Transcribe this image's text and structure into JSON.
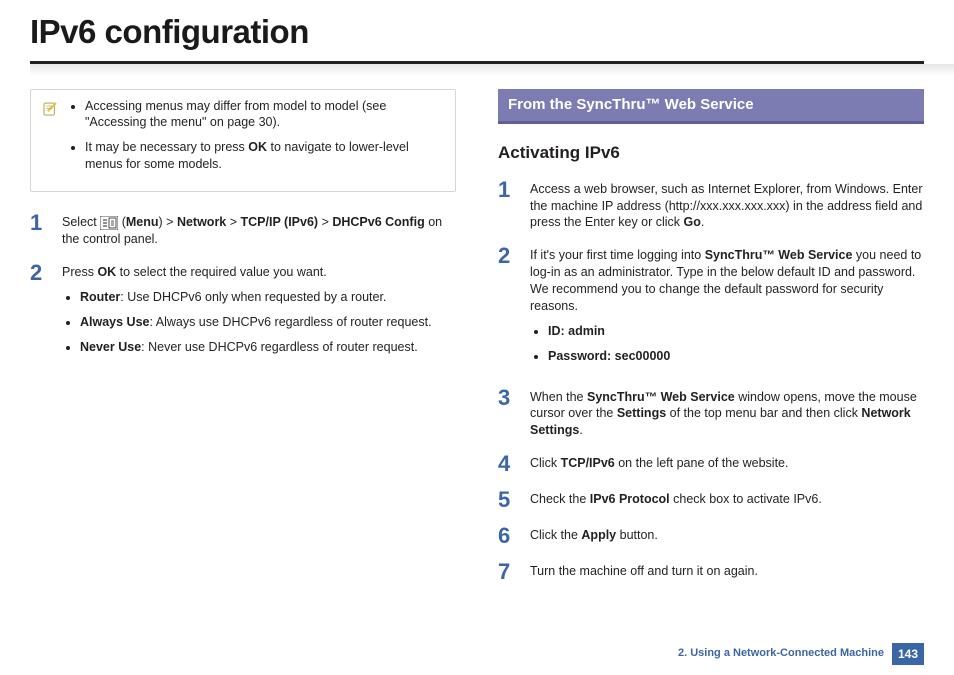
{
  "title": "IPv6 configuration",
  "left": {
    "note": {
      "items": [
        {
          "pre": "Accessing menus may differ from model to model (see \"Accessing the menu\" on page 30)."
        },
        {
          "pre": "It may be necessary to press ",
          "b1": "OK",
          "post": " to navigate to lower-level menus for some models."
        }
      ]
    },
    "step1": {
      "num": "1",
      "pre": "Select ",
      "post1": " (",
      "b1": "Menu",
      "post2": ") > ",
      "b2": "Network",
      "post3": " > ",
      "b3": "TCP/IP (IPv6)",
      "post4": " > ",
      "b4": "DHCPv6 Config",
      "post5": " on the control panel."
    },
    "step2": {
      "num": "2",
      "text_pre": "Press ",
      "text_b": "OK",
      "text_post": " to select the required value you want.",
      "items": [
        {
          "b": "Router",
          "text": ": Use DHCPv6 only when requested by a router."
        },
        {
          "b": "Always Use",
          "text": ": Always use DHCPv6 regardless of router request."
        },
        {
          "b": "Never Use",
          "text": ": Never use DHCPv6 regardless of router request."
        }
      ]
    }
  },
  "right": {
    "section_bar": "From the SyncThru™ Web Service",
    "h3": "Activating IPv6",
    "steps": {
      "s1": {
        "num": "1",
        "pre": "Access a web browser, such as Internet Explorer, from Windows.  Enter the machine IP address (http://xxx.xxx.xxx.xxx) in the address field and press the Enter key or click ",
        "b": "Go",
        "post": "."
      },
      "s2": {
        "num": "2",
        "pre": "If it's your first time logging into ",
        "b": "SyncThru™ Web Service",
        "post": " you need to log-in as an administrator. Type in the below default ID and password. We recommend you to change the default password for security reasons.",
        "creds": [
          {
            "label": "ID: admin"
          },
          {
            "label": "Password: sec00000"
          }
        ]
      },
      "s3": {
        "num": "3",
        "p1": "When the ",
        "b1": "SyncThru™ Web Service",
        "p2": " window opens, move the mouse cursor over the ",
        "b2": "Settings",
        "p3": " of the top menu bar and then click ",
        "b3": "Network Settings",
        "p4": "."
      },
      "s4": {
        "num": "4",
        "pre": "Click ",
        "b": "TCP/IPv6",
        "post": " on the left pane of the website."
      },
      "s5": {
        "num": "5",
        "pre": "Check the ",
        "b": "IPv6 Protocol",
        "post": " check box to activate IPv6."
      },
      "s6": {
        "num": "6",
        "pre": "Click the ",
        "b": "Apply",
        "post": " button."
      },
      "s7": {
        "num": "7",
        "text": "Turn the machine off and turn it on again."
      }
    }
  },
  "footer": {
    "chapter": "2.  Using a Network-Connected Machine",
    "page": "143"
  }
}
